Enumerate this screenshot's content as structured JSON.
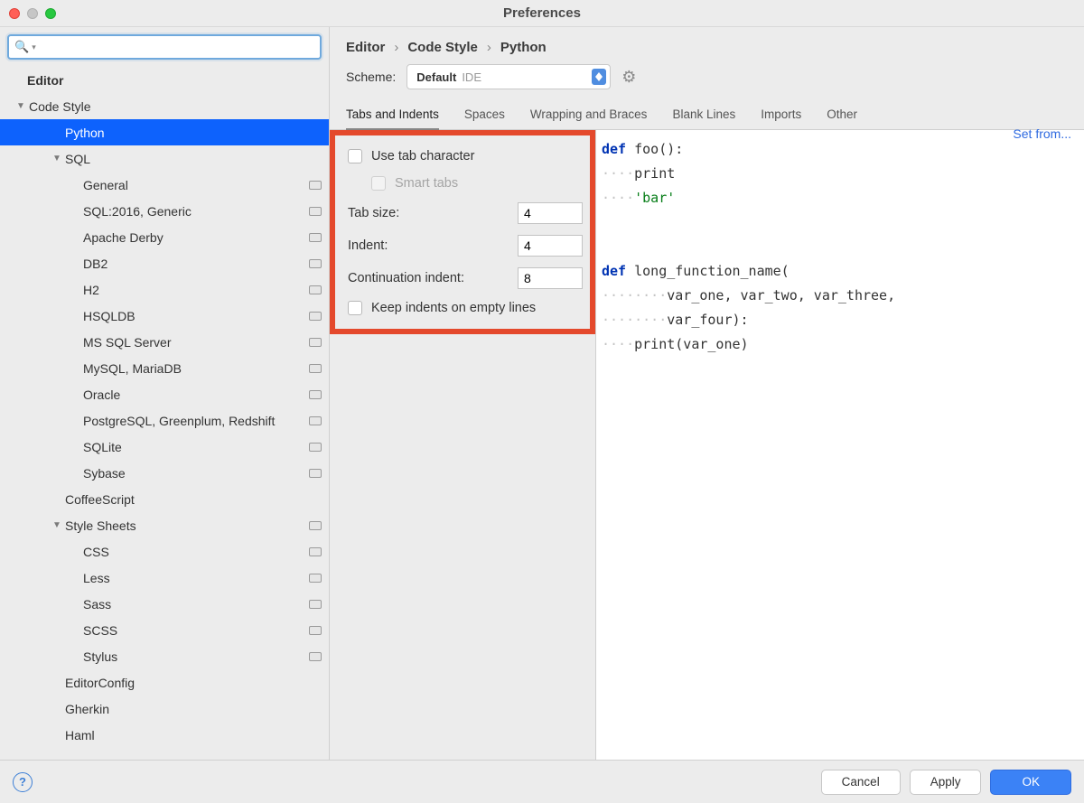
{
  "window": {
    "title": "Preferences"
  },
  "search": {
    "placeholder": ""
  },
  "sidebar": {
    "root": "Editor",
    "codeStyle": "Code Style",
    "python": "Python",
    "sql": "SQL",
    "sqlItems": [
      "General",
      "SQL:2016, Generic",
      "Apache Derby",
      "DB2",
      "H2",
      "HSQLDB",
      "MS SQL Server",
      "MySQL, MariaDB",
      "Oracle",
      "PostgreSQL, Greenplum, Redshift",
      "SQLite",
      "Sybase"
    ],
    "coffee": "CoffeeScript",
    "styleSheets": "Style Sheets",
    "ssItems": [
      "CSS",
      "Less",
      "Sass",
      "SCSS",
      "Stylus"
    ],
    "editorConfig": "EditorConfig",
    "gherkin": "Gherkin",
    "haml": "Haml"
  },
  "breadcrumb": {
    "a": "Editor",
    "b": "Code Style",
    "c": "Python"
  },
  "scheme": {
    "label": "Scheme:",
    "value": "Default",
    "tag": "IDE"
  },
  "setFrom": "Set from...",
  "tabs": [
    "Tabs and Indents",
    "Spaces",
    "Wrapping and Braces",
    "Blank Lines",
    "Imports",
    "Other"
  ],
  "settings": {
    "useTabChar": "Use tab character",
    "smartTabs": "Smart tabs",
    "tabSizeLabel": "Tab size:",
    "tabSize": "4",
    "indentLabel": "Indent:",
    "indent": "4",
    "contLabel": "Continuation indent:",
    "cont": "8",
    "keepIndents": "Keep indents on empty lines"
  },
  "preview": {
    "l1a": "def",
    "l1b": " foo():",
    "l2dots": "····",
    "l2": "print",
    "l3dots": "····",
    "l3": "'bar'",
    "blank": "",
    "l5a": "def",
    "l5b": " long_function_name(",
    "l6dots": "········",
    "l6": "var_one, var_two, var_three,",
    "l7dots": "········",
    "l7": "var_four):",
    "l8dots": "····",
    "l8": "print(var_one)"
  },
  "footer": {
    "cancel": "Cancel",
    "apply": "Apply",
    "ok": "OK"
  }
}
